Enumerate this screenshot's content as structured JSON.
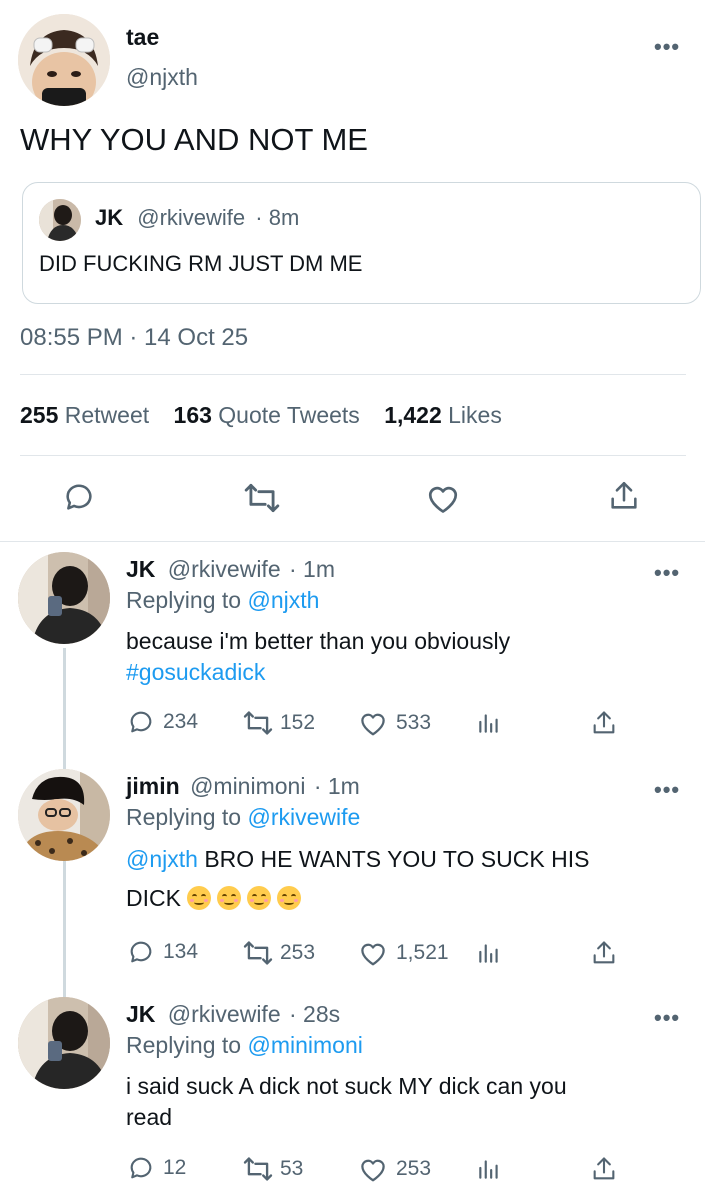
{
  "main_tweet": {
    "display_name": "tae",
    "handle": "@njxth",
    "text": "WHY YOU AND NOT ME",
    "more_icon": "ellipsis-icon",
    "quoted": {
      "display_name": "JK",
      "handle": "@rkivewife",
      "time": "· 8m",
      "text": "DID FUCKING RM JUST DM ME"
    },
    "timestamp": "08:55 PM · 14 Oct 25",
    "stats": {
      "retweets": "255",
      "retweets_label": "Retweet",
      "quotes": "163",
      "quotes_label": "Quote Tweets",
      "likes": "1,422",
      "likes_label": "Likes"
    },
    "actions": [
      "reply-icon",
      "retweet-icon",
      "like-icon",
      "share-icon"
    ]
  },
  "replies": [
    {
      "display_name": "JK",
      "handle": "@rkivewife",
      "time": "· 1m",
      "replying_prefix": "Replying to",
      "replying_to": "@njxth",
      "text_line1": "because i'm better than you obviously",
      "hashtag": "#gosuckadick",
      "reply_count": "234",
      "retweet_count": "152",
      "like_count": "533"
    },
    {
      "display_name": "jimin",
      "handle": "@minimoni",
      "time": "· 1m",
      "replying_prefix": "Replying to",
      "replying_to": "@rkivewife",
      "mention": "@njxth",
      "text_line1": " BRO HE WANTS YOU TO SUCK HIS",
      "text_line2": "DICK",
      "emoji_count": 4,
      "reply_count": "134",
      "retweet_count": "253",
      "like_count": "1,521"
    },
    {
      "display_name": "JK",
      "handle": "@rkivewife",
      "time": "· 28s",
      "replying_prefix": "Replying to",
      "replying_to": "@minimoni",
      "text_line1": "i said suck A dick not suck MY dick can you",
      "text_line2": "read",
      "reply_count": "12",
      "retweet_count": "53",
      "like_count": "253"
    }
  ],
  "colors": {
    "link": "#1d9bf0",
    "muted": "#536471",
    "text": "#0f1419",
    "border": "#cfd9de"
  }
}
